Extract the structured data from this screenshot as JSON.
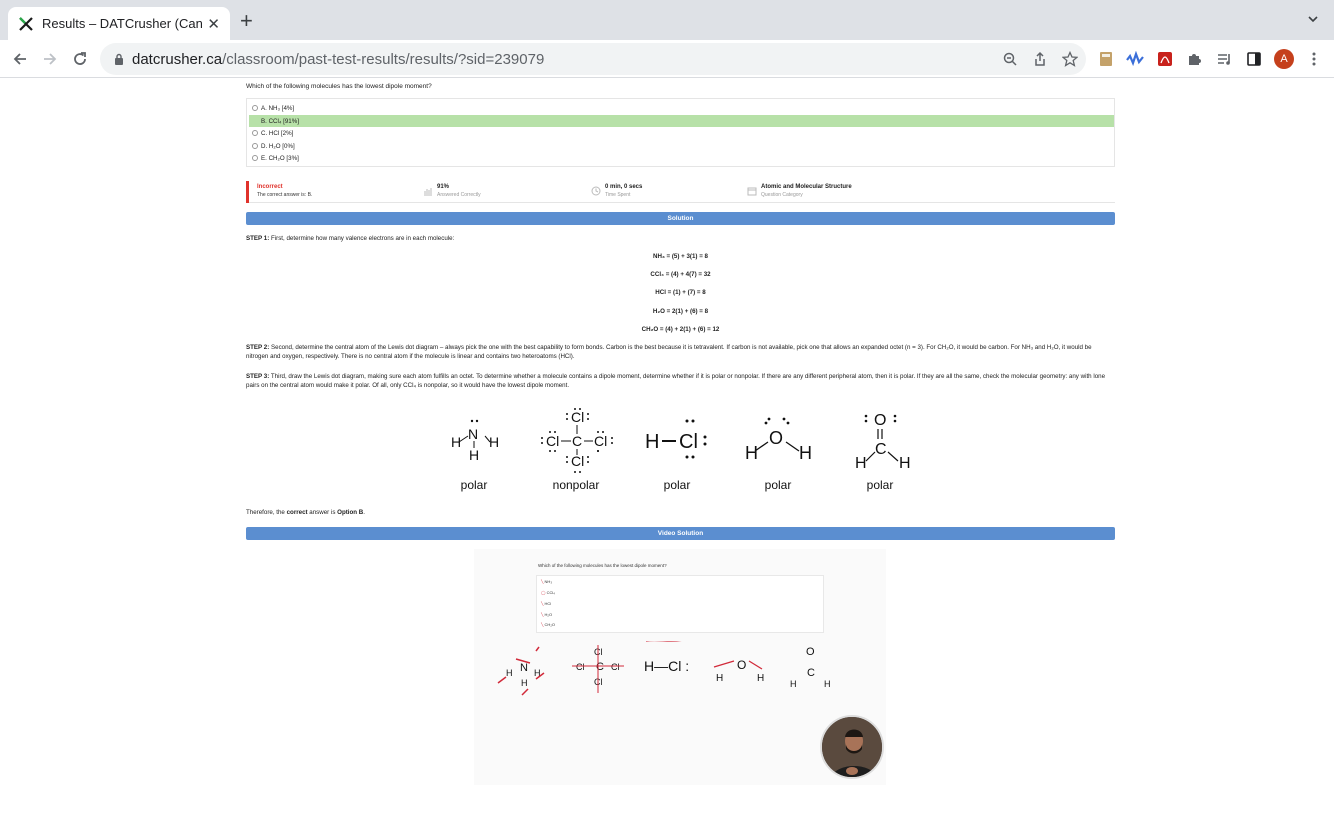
{
  "browser": {
    "tab_title": "Results – DATCrusher (Canadian",
    "url_domain": "datcrusher.ca",
    "url_path": "/classroom/past-test-results/results/?sid=239079",
    "avatar_letter": "A",
    "accent_color": "#5b8ed0"
  },
  "question": {
    "text": "Which of the following molecules has the lowest dipole moment?",
    "options": [
      {
        "label": "A. NH₃ [4%]",
        "correct": false
      },
      {
        "label": "B. CCl₄ [91%]",
        "correct": true
      },
      {
        "label": "C. HCl [2%]",
        "correct": false
      },
      {
        "label": "D. H₂O [0%]",
        "correct": false
      },
      {
        "label": "E. CH₂O [3%]",
        "correct": false
      }
    ]
  },
  "stats": {
    "status": "Incorrect",
    "status_sub": "The correct answer is: B.",
    "percent": "91%",
    "percent_sub": "Answered Correctly",
    "time": "0 min, 0 secs",
    "time_sub": "Time Spent",
    "category": "Atomic and Molecular Structure",
    "category_sub": "Question Category"
  },
  "solution": {
    "banner": "Solution",
    "step1_label": "STEP 1:",
    "step1_text": " First, determine how many valence electrons are in each molecule:",
    "equations": [
      "NH₃ = (5) + 3(1) = 8",
      "CCl₄ = (4) + 4(7) = 32",
      "HCl = (1) + (7) = 8",
      "H₂O = 2(1) + (6) = 8",
      "CH₂O = (4) + 2(1) + (6) = 12"
    ],
    "step2_label": "STEP 2:",
    "step2_text": " Second, determine the central atom of the Lewis dot diagram – always pick the one with the best capability to form bonds. Carbon is the best because it is tetravalent. If carbon is not available, pick one that allows an expanded octet (n = 3). For CH₂O, it would be carbon. For NH₃ and H₂O, it would be nitrogen and oxygen, respectively. There is no central atom if the molecule is linear and contains two heteroatoms (HCl).",
    "step3_label": "STEP 3:",
    "step3_text": " Third, draw the Lewis dot diagram, making sure each atom fulfills an octet. To determine whether a molecule contains a dipole moment, determine whether if it is polar or nonpolar. If there are any different peripheral atom, then it is polar. If they are all the same, check the molecular geometry: any with lone pairs on the central atom would make it polar. Of all, only CCl₄ is nonpolar, so it would have the lowest dipole moment.",
    "polarity_labels": [
      "polar",
      "nonpolar",
      "polar",
      "polar",
      "polar"
    ],
    "conclusion_pre": "Therefore, the ",
    "conclusion_bold": "correct",
    "conclusion_mid": " answer is ",
    "conclusion_answer": "Option B",
    "conclusion_end": "."
  },
  "video": {
    "banner": "Video Solution",
    "question": "Which of the following molecules has the lowest dipole moment?",
    "options": [
      "NH₃",
      "CCl₄",
      "HCl",
      "H₂O",
      "CH₂O"
    ]
  }
}
